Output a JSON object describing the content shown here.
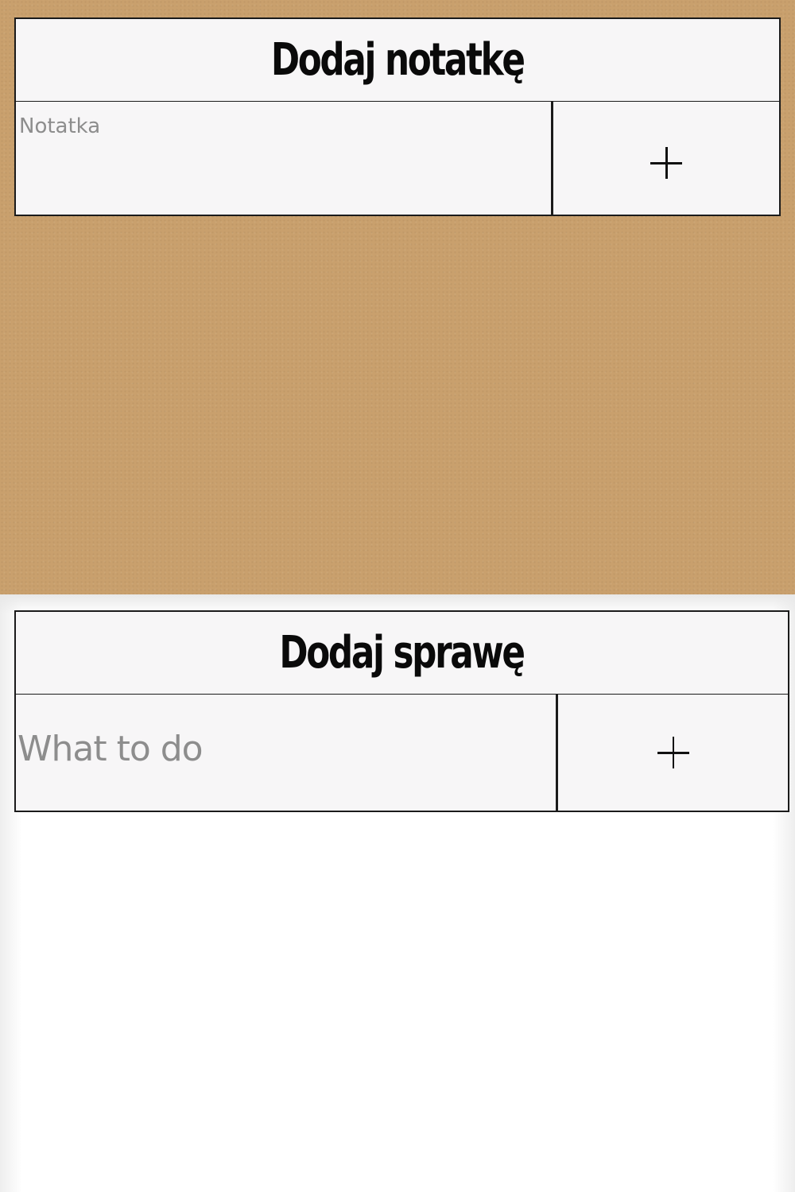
{
  "note_form": {
    "title": "Dodaj notatkę",
    "input_placeholder": "Notatka",
    "input_value": "",
    "add_button_label": "+"
  },
  "task_form": {
    "title": "Dodaj sprawę",
    "input_placeholder": "What to do",
    "input_value": "",
    "add_button_label": "+"
  },
  "colors": {
    "cork_background": "#c9a06d",
    "card_background": "#f7f6f7",
    "border": "#1b1b1b",
    "placeholder_text": "#8d8d8d"
  },
  "icons": {
    "note_add": "plus-icon",
    "task_add": "plus-icon"
  }
}
